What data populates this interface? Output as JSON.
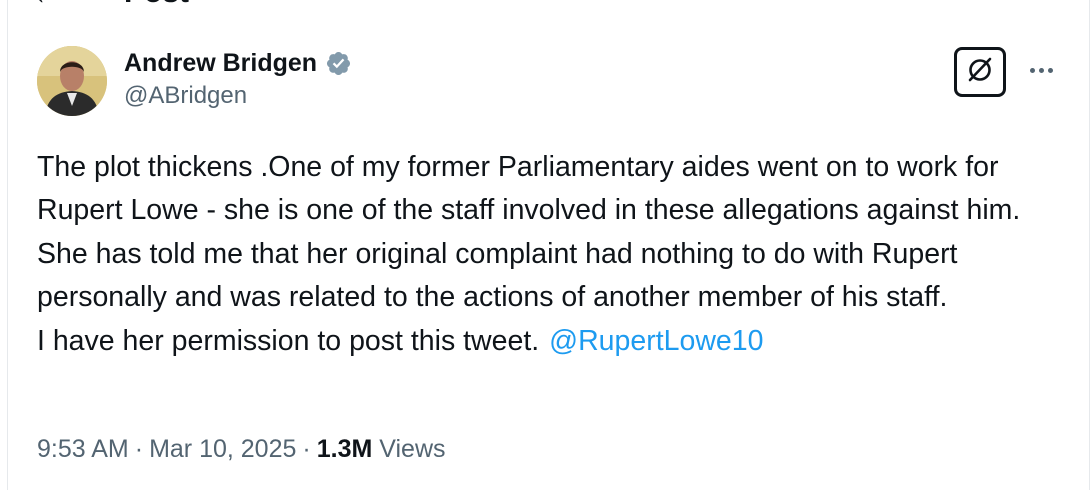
{
  "header": {
    "title": "Post"
  },
  "author": {
    "display_name": "Andrew Bridgen",
    "handle": "@ABridgen",
    "verified": true,
    "verified_color": "#829aab"
  },
  "tweet": {
    "text_main": "The plot thickens .One of my former Parliamentary aides went on to work for Rupert Lowe - she is one of the staff involved in these allegations against him. She has told me that her original complaint had nothing to do with Rupert personally and was related to the actions of another member of his staff.",
    "text_last": "I have her permission to post this tweet.",
    "mention": "@RupertLowe10"
  },
  "meta": {
    "time": "9:53 AM",
    "date": "Mar 10, 2025",
    "views_count": "1.3M",
    "views_label": "Views"
  },
  "colors": {
    "link": "#1d9bf0",
    "secondary_text": "#536471",
    "primary_text": "#0f1419"
  },
  "icons": {
    "back": "arrow-left-icon",
    "verified": "verified-badge-icon",
    "grok": "grok-icon",
    "more": "more-horizontal-icon"
  }
}
